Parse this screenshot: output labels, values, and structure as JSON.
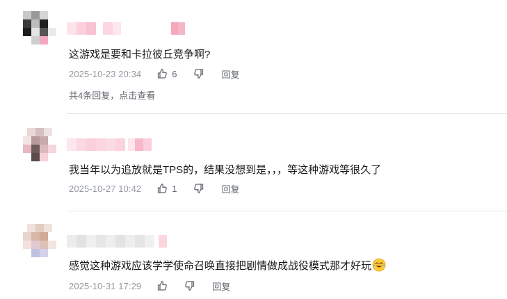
{
  "comments": [
    {
      "text": "这游戏是要和卡拉彼丘竞争啊?",
      "time": "2025-10-23 20:34",
      "like_count": "6",
      "reply_label": "回复",
      "sub_replies": "共4条回复，点击查看"
    },
    {
      "text": "我当年以为追放就是TPS的，结果没想到是，，，等这种游戏等很久了",
      "time": "2025-10-27 10:42",
      "like_count": "1",
      "reply_label": "回复"
    },
    {
      "text": "感觉这种游戏应该学学使命召唤直接把剧情做成战役模式那才好玩",
      "time": "2025-10-31 17:29",
      "reply_label": "回复"
    }
  ],
  "icons": {
    "like": "thumbs-up-icon",
    "dislike": "thumbs-down-icon",
    "emoji": "laughing-tears-emoji"
  },
  "colors": {
    "text": "#18191c",
    "meta": "#9499a0",
    "action": "#61666d",
    "divider": "#e3e5e7",
    "nickname_blur": "#f7b8c8"
  }
}
